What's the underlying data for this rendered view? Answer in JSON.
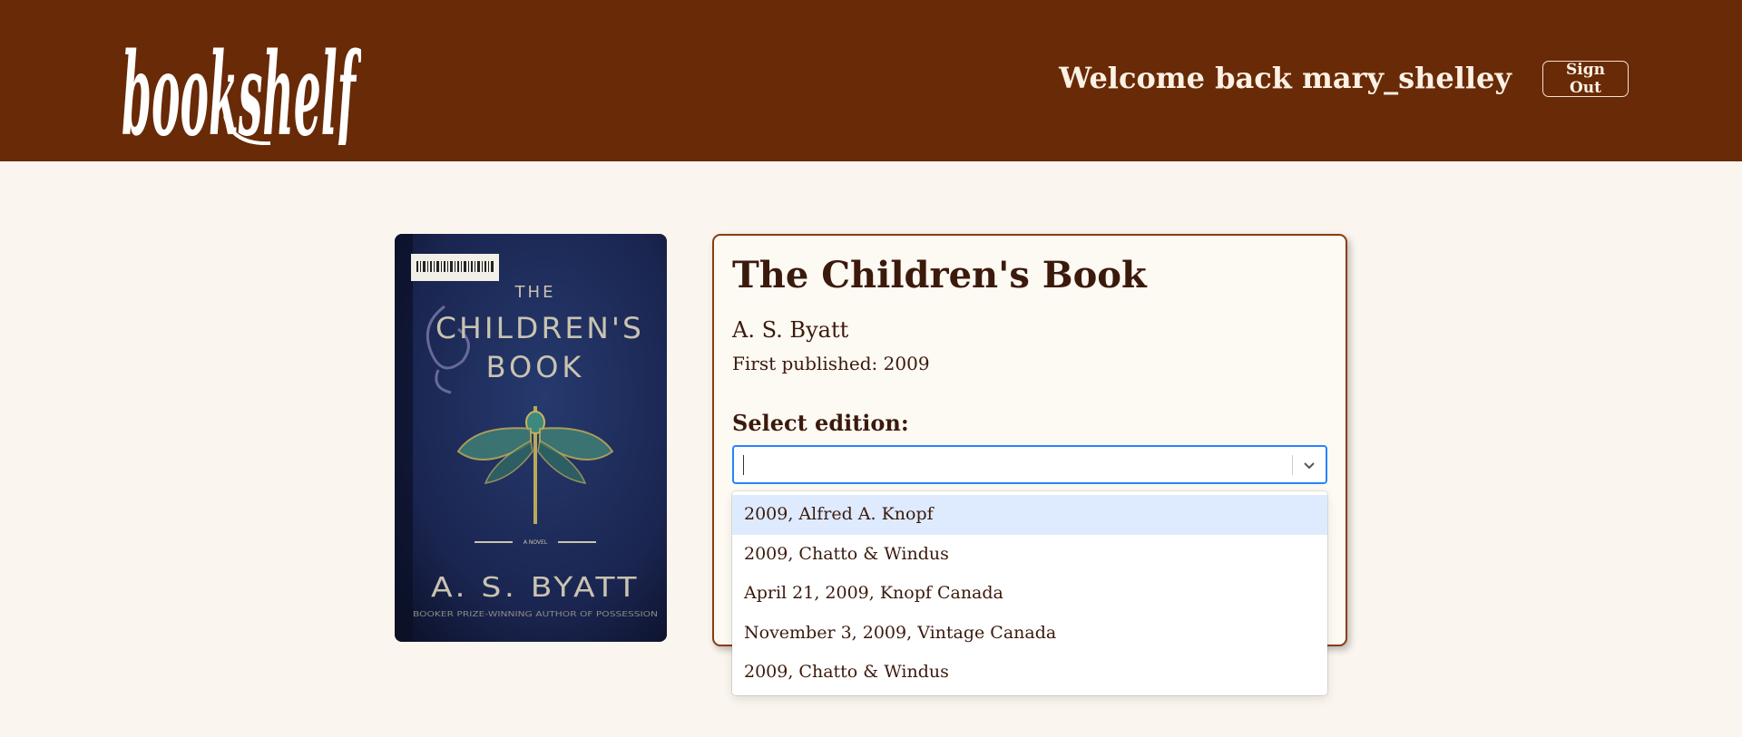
{
  "header": {
    "logo_text": "bookshelf",
    "welcome_text": "Welcome back mary_shelley",
    "sign_out_label": "Sign Out"
  },
  "cover": {
    "title_line1": "THE",
    "title_line2": "CHILDREN'S",
    "title_line3": "BOOK",
    "novel_label": "A NOVEL",
    "author": "A. S. BYATT",
    "tagline": "BOOKER PRIZE-WINNING AUTHOR OF POSSESSION"
  },
  "book": {
    "title": "The Children's Book",
    "author": "A. S. Byatt",
    "first_published": "First published: 2009"
  },
  "edition_select": {
    "label": "Select edition:",
    "value": "",
    "options": [
      "2009, Alfred A. Knopf",
      "2009, Chatto & Windus",
      "April 21, 2009, Knopf Canada",
      "November 3, 2009, Vintage Canada",
      "2009, Chatto & Windus"
    ]
  },
  "colors": {
    "header_bg": "#692a07",
    "page_bg": "#faf5ee",
    "text": "#3b1a0c",
    "card_border": "#8a3c12",
    "focus_border": "#2684ff",
    "option_highlight": "#deebff"
  }
}
